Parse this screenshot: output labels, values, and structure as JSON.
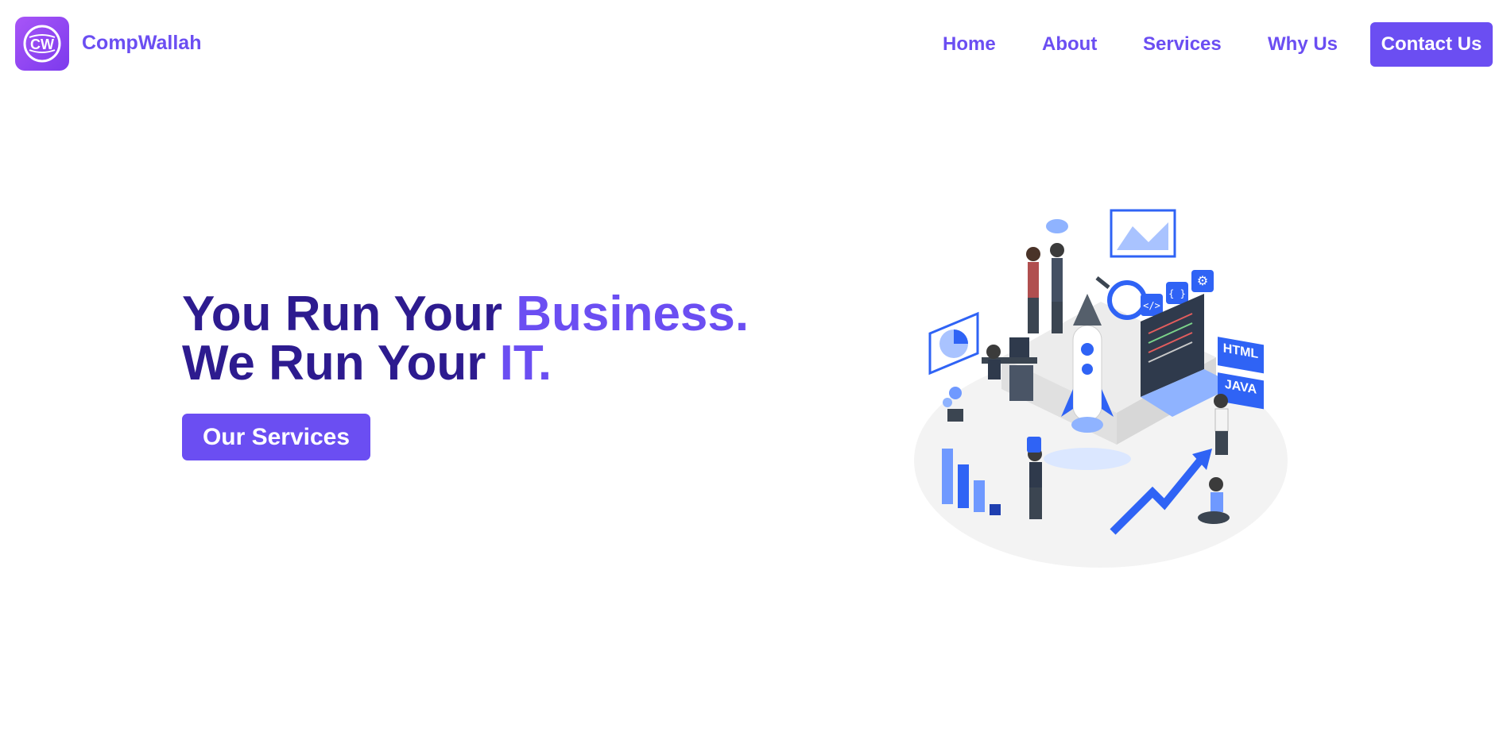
{
  "nav": {
    "logo_monogram": "CW",
    "brand": "CompWallah",
    "links": [
      "Home",
      "About",
      "Services",
      "Why Us"
    ],
    "cta": "Contact Us"
  },
  "hero": {
    "line1_part1": "You Run Your",
    "line1_part2": "Business.",
    "line2_part1": "We Run Your",
    "line2_part2": "IT.",
    "button": "Our Services"
  },
  "illustration": {
    "badges": [
      "HTML",
      "JAVA"
    ],
    "code_icons": [
      "</>",
      "{ }"
    ]
  },
  "colors": {
    "accent": "#6b4ef2",
    "title_dark": "#2d1b8f",
    "title_mid": "#4a2fd0",
    "illustration_blue": "#2f63f5"
  }
}
